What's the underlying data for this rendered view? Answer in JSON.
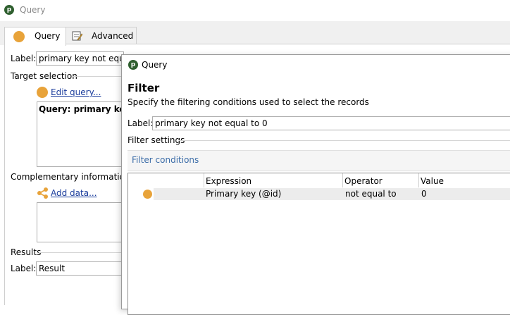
{
  "window": {
    "title": "Query",
    "logo_letter": "p"
  },
  "tabs": [
    {
      "label": "Query",
      "icon": "orange-circle-icon",
      "active": true
    },
    {
      "label": "Advanced",
      "icon": "document-edit-icon",
      "active": false
    }
  ],
  "background_form": {
    "label_caption": "Label:",
    "label_value": "primary key not equal",
    "target_selection_title": "Target selection",
    "edit_query_link": "Edit query...",
    "query_summary": "Query: primary key n",
    "complementary_title": "Complementary information",
    "add_data_link": "Add data...",
    "results_title": "Results",
    "results_label_caption": "Label:",
    "results_label_value": "Result"
  },
  "dialog": {
    "title": "Query",
    "heading": "Filter",
    "subtitle": "Specify the filtering conditions used to select the records",
    "label_caption": "Label:",
    "label_value": "primary key not equal to 0",
    "filter_settings_title": "Filter settings",
    "filter_conditions_tab": "Filter conditions",
    "grid": {
      "columns": [
        "Expression",
        "Operator",
        "Value"
      ],
      "rows": [
        {
          "expression": "Primary key (@id)",
          "operator": "not equal to",
          "value": "0"
        }
      ]
    }
  },
  "colors": {
    "accent_orange": "#e8a33a",
    "link_blue": "#1a3c9c",
    "filter_tab_blue": "#3c6da8"
  }
}
